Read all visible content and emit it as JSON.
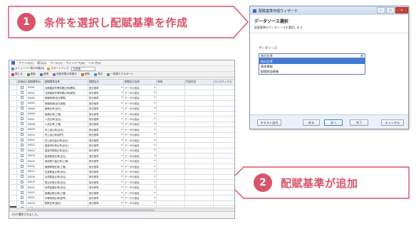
{
  "callouts": [
    {
      "number": "1",
      "text": "条件を選択し配賦基準を作成"
    },
    {
      "number": "2",
      "text": "配賦基準が追加"
    }
  ],
  "colors": {
    "accent": "#d9536a",
    "selection": "#3c7ad6"
  },
  "app": {
    "menu": [
      "ファイル(F)",
      "表示(V)",
      "ツール(T)",
      "ウィンドウ(W)",
      "ヘルプ(H)"
    ],
    "toolbar1": {
      "menu_display": "メニューバー表示切替(M)",
      "startup": "スタートアップ",
      "select_value": "日本語"
    },
    "toolbar2": [
      "閉じる",
      "更新",
      "新規",
      "前回作業の再表示",
      "削除",
      "表示",
      "一覧表エクスポート"
    ],
    "columns": [
      "",
      "採用区分",
      "配賦基準No",
      "配賦基準名称",
      "配賦区分",
      "配賦区分名称",
      "説明",
      "内容内容",
      "ロジスティクス"
    ],
    "rows": [
      [
        "",
        "S0001",
        "当期直接作業時間比率(標準)",
        "按分基準",
        "データの追加"
      ],
      [
        "",
        "S0002",
        "当期直接作業時間比率(実際)",
        "按分基準",
        "データの追加"
      ],
      [
        "",
        "S0003",
        "稼働時間(全社標準)",
        "按分基準",
        "データの追加"
      ],
      [
        "",
        "S0004",
        "稼働時間(全社実際)",
        "按分基準",
        "データの追加"
      ],
      [
        "",
        "S0005",
        "面積比率(全社)",
        "按分基準",
        "データの追加"
      ],
      [
        "",
        "S0006",
        "面積比率(工場)",
        "按分基準",
        "データの追加"
      ],
      [
        "",
        "S0007",
        "人員比率(全社)",
        "按分基準",
        "データの追加"
      ],
      [
        "",
        "S0008",
        "人員比率(工場)",
        "按分基準",
        "データの追加"
      ],
      [
        "",
        "S0009",
        "売上高比率(全社)",
        "按分基準",
        "データの追加"
      ],
      [
        "",
        "S0010",
        "売上高比率(部門)",
        "按分基準",
        "データの追加"
      ],
      [
        "",
        "S0011",
        "売上総利益比率(全社)",
        "按分基準",
        "データの追加"
      ],
      [
        "",
        "S0012",
        "直接材料費比率(全社)",
        "按分基準",
        "データの追加"
      ],
      [
        "",
        "S0013",
        "直接労務費比率(全社)",
        "按分基準",
        "データの追加"
      ],
      [
        "",
        "S0014",
        "製造原価比率(全社)",
        "按分基準",
        "データの追加"
      ],
      [
        "",
        "S0015",
        "使用電力量比率(工場)",
        "按分基準",
        "データの追加"
      ],
      [
        "",
        "S0016",
        "機械時間比率(工場)",
        "按分基準",
        "データの追加"
      ],
      [
        "",
        "S0017",
        "生産数量比率(全社)",
        "按分基準",
        "データの追加"
      ],
      [
        "",
        "S0018",
        "出荷数量比率(全社)",
        "按分基準",
        "データの追加"
      ],
      [
        "",
        "S0019",
        "受注件数比率(全社)",
        "按分基準",
        "データの追加"
      ],
      [
        "",
        "S0020",
        "在庫金額比率(全社)",
        "按分基準",
        "データの追加"
      ],
      [
        "",
        "S0021",
        "設備台数比率(工場)",
        "按分基準",
        "データの追加"
      ],
      [
        "",
        "S0022",
        "作業時間比率(部門)",
        "按分基準",
        "データの追加"
      ],
      [
        "",
        "S0023",
        "配賦比率(固定)",
        "按分基準",
        "データの追加"
      ]
    ],
    "new_row": {
      "marker": "*",
      "no": "A001",
      "name": "新規配賦基準",
      "kubun": "按分基準",
      "kubun_name": "データの追加",
      "desc": "1000000 入庫数量",
      "content": "データベース"
    },
    "status": "1行が選択されました。"
  },
  "wizard": {
    "title": "配賦基準作成ウィザード",
    "controls": [
      "−",
      "□",
      "×"
    ],
    "heading": "データソース選択",
    "subheading": "配賦基準のデータソースを選択します",
    "ds_label": "データソース",
    "ds_selected": "按分比率",
    "ds_options": [
      "按分比率",
      "基本情報",
      "配賦割当情報"
    ],
    "buttons": [
      "テキスト出力",
      "戻る",
      "次へ",
      "完了",
      "キャンセル"
    ]
  }
}
